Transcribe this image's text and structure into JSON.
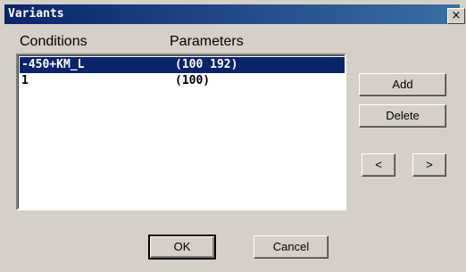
{
  "window": {
    "title": "Variants",
    "close_label": "×"
  },
  "headers": {
    "conditions": "Conditions",
    "parameters": "Parameters"
  },
  "rows": [
    {
      "condition": "-450+KM_L",
      "parameters": "(100 192)",
      "selected": true
    },
    {
      "condition": "1",
      "parameters": "(100)",
      "selected": false
    }
  ],
  "buttons": {
    "add": "Add",
    "delete": "Delete",
    "prev": "<",
    "next": ">",
    "ok": "OK",
    "cancel": "Cancel"
  },
  "colors": {
    "titlebar": "#0a246a",
    "selection": "#0a246a",
    "face": "#d4d0c8"
  }
}
